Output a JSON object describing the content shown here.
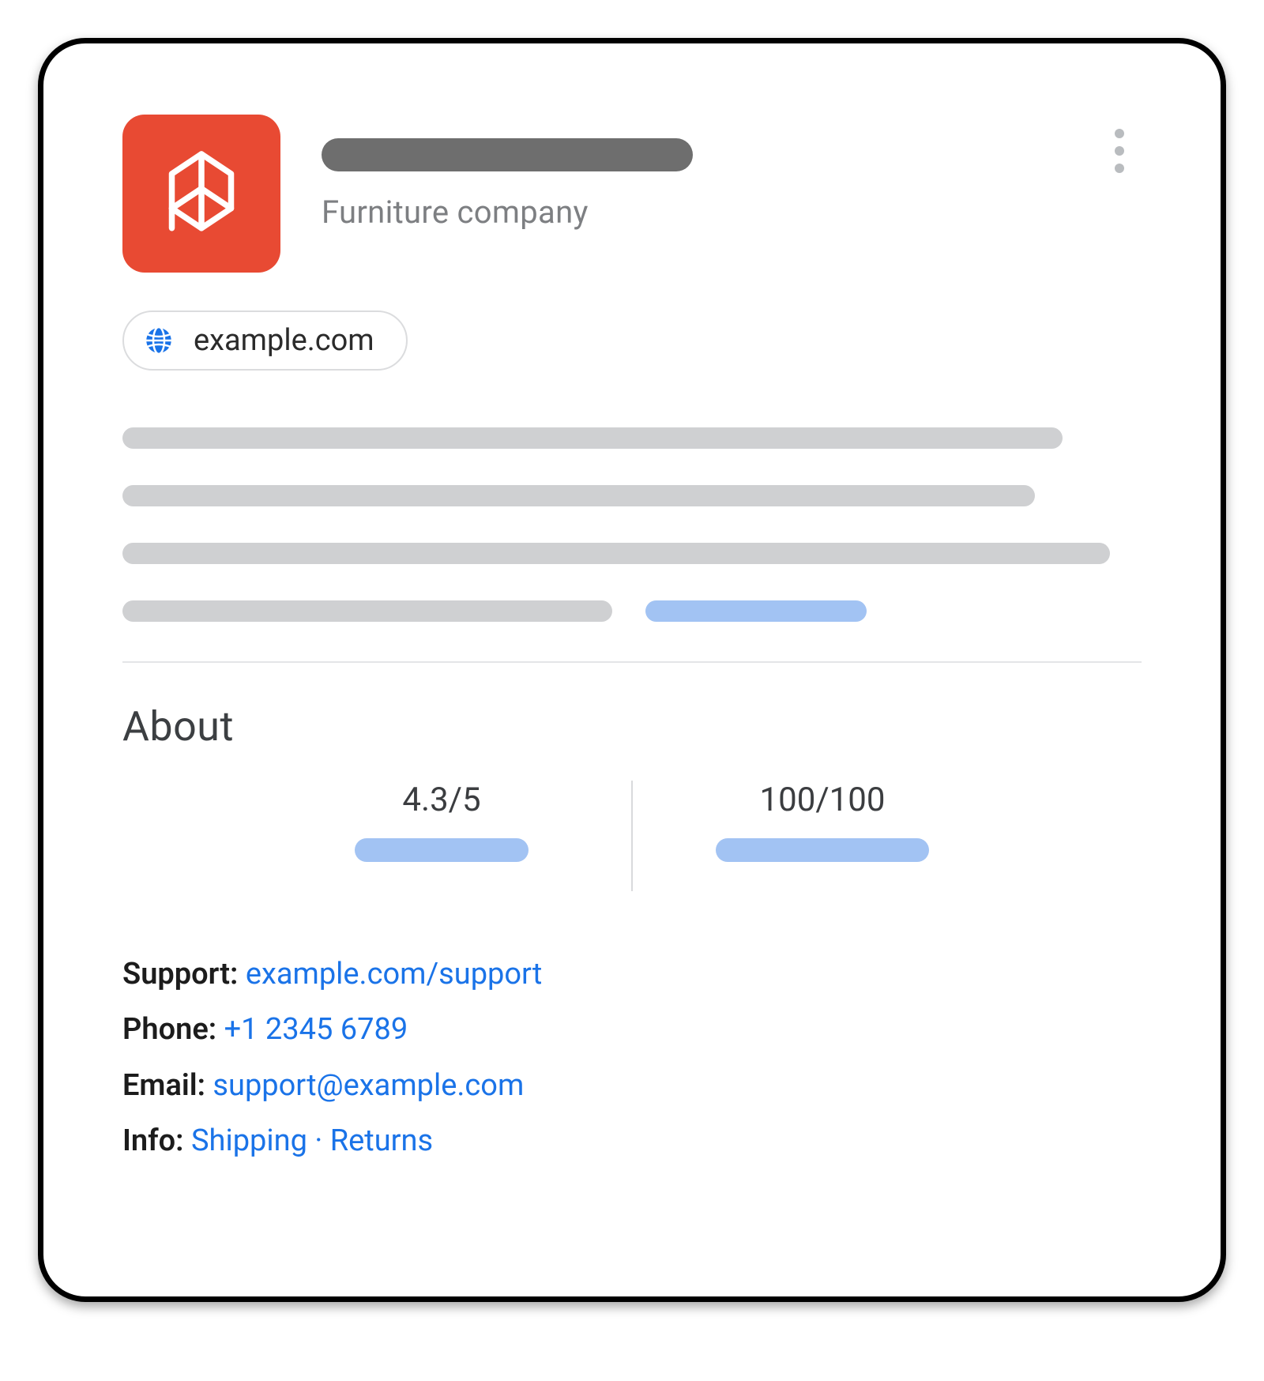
{
  "header": {
    "subtitle": "Furniture company",
    "domain": "example.com"
  },
  "about": {
    "heading": "About",
    "stats": {
      "rating": "4.3/5",
      "score": "100/100"
    },
    "support_label": "Support:",
    "support_link": "example.com/support",
    "phone_label": "Phone:",
    "phone_link": "+1 2345 6789",
    "email_label": "Email:",
    "email_link": "support@example.com",
    "info_label": "Info:",
    "info_link_shipping": "Shipping",
    "info_link_returns": "Returns",
    "info_separator": " · "
  }
}
